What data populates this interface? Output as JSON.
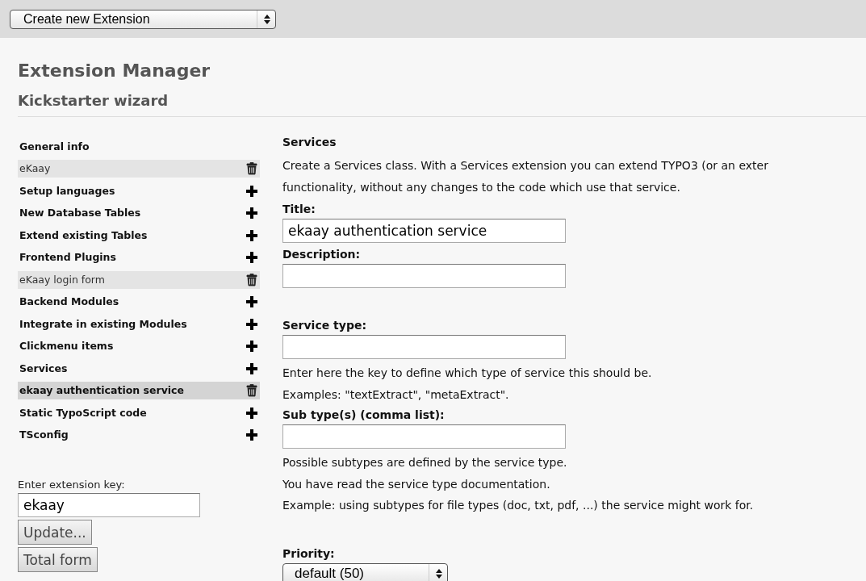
{
  "top_bar": {
    "select": "Create new Extension"
  },
  "title": "Extension Manager",
  "subtitle": "Kickstarter wizard",
  "sidebar": {
    "items": [
      {
        "kind": "heading",
        "label": "General info"
      },
      {
        "kind": "entry",
        "label": "eKaay",
        "selected": false
      },
      {
        "kind": "section",
        "label": "Setup languages"
      },
      {
        "kind": "section",
        "label": "New Database Tables"
      },
      {
        "kind": "section",
        "label": "Extend existing Tables"
      },
      {
        "kind": "section",
        "label": "Frontend Plugins"
      },
      {
        "kind": "entry",
        "label": "eKaay login form",
        "selected": false
      },
      {
        "kind": "section",
        "label": "Backend Modules"
      },
      {
        "kind": "section",
        "label": "Integrate in existing Modules"
      },
      {
        "kind": "section",
        "label": "Clickmenu items"
      },
      {
        "kind": "section",
        "label": "Services"
      },
      {
        "kind": "entry",
        "label": "ekaay authentication service",
        "selected": true
      },
      {
        "kind": "section",
        "label": "Static TypoScript code"
      },
      {
        "kind": "section",
        "label": "TSconfig"
      }
    ],
    "key_label": "Enter extension key:",
    "key_value": "ekaay",
    "buttons": [
      "Update...",
      "Total form"
    ]
  },
  "form": {
    "heading": "Services",
    "intro": [
      "Create a Services class. With a Services extension you can extend TYPO3 (or an exter",
      "functionality, without any changes to the code which use that service."
    ],
    "field_groups": [
      [
        {
          "kind": "text",
          "label": "Title:",
          "value": "ekaay authentication service"
        },
        {
          "kind": "text",
          "label": "Description:"
        }
      ],
      [
        {
          "kind": "text",
          "label": "Service type:",
          "notes": [
            "Enter here the key to define which type of service this should be.",
            "Examples: \"textExtract\", \"metaExtract\"."
          ]
        },
        {
          "kind": "text",
          "label": "Sub type(s) (comma list):",
          "notes": [
            "Possible subtypes are defined by the service type.",
            "You have read the service type documentation.",
            "Example: using subtypes for file types (doc, txt, pdf, ...) the service might work for."
          ]
        }
      ],
      [
        {
          "kind": "select",
          "label": "Priority:",
          "value": "default (50)"
        }
      ]
    ]
  }
}
